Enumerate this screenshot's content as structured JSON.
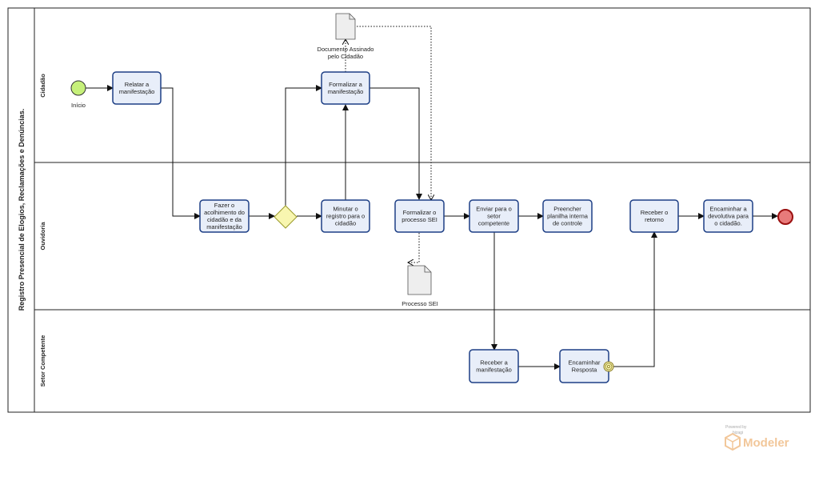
{
  "pool": {
    "title": "Registro Presencial de Elogios, Reclamações e Denúncias."
  },
  "lanes": [
    {
      "id": "cidadao",
      "name": "Cidadão"
    },
    {
      "id": "ouvidoria",
      "name": "Ouvidoria"
    },
    {
      "id": "setor",
      "name": "Setor Competente"
    }
  ],
  "events": {
    "start": {
      "label": "Início",
      "color": "#c6f07a"
    },
    "end": {
      "label": "",
      "color": "#e87a7a"
    }
  },
  "tasks": [
    {
      "id": "t1",
      "lines": [
        "Relatar a",
        "manifestação"
      ]
    },
    {
      "id": "t2",
      "lines": [
        "Formalizar a",
        "manifestação"
      ]
    },
    {
      "id": "t3",
      "lines": [
        "Fazer o",
        "acolhimento do",
        "cidadão e da",
        "manifestação"
      ]
    },
    {
      "id": "t4",
      "lines": [
        "Minutar o",
        "registro para o",
        "cidadão"
      ]
    },
    {
      "id": "t5",
      "lines": [
        "Formalizar o",
        "processo SEI"
      ]
    },
    {
      "id": "t6",
      "lines": [
        "Enviar para o",
        "setor",
        "competente"
      ]
    },
    {
      "id": "t7",
      "lines": [
        "Preencher",
        "planilha interna",
        "de controle"
      ]
    },
    {
      "id": "t8",
      "lines": [
        "Receber o",
        "retorno"
      ]
    },
    {
      "id": "t9",
      "lines": [
        "Encaminhar a",
        "devolutiva para",
        "o cidadão."
      ]
    },
    {
      "id": "t10",
      "lines": [
        "Receber a",
        "manifestação"
      ]
    },
    {
      "id": "t11",
      "lines": [
        "Encaminhar",
        "Resposta"
      ]
    }
  ],
  "documents": [
    {
      "id": "d1",
      "lines": [
        "Documento Assinado",
        "pelo Cidadão"
      ]
    },
    {
      "id": "d2",
      "lines": [
        "Processo SEI"
      ]
    }
  ],
  "branding": {
    "powered": "Powered by",
    "company": "bizagi",
    "product": "Modeler"
  }
}
